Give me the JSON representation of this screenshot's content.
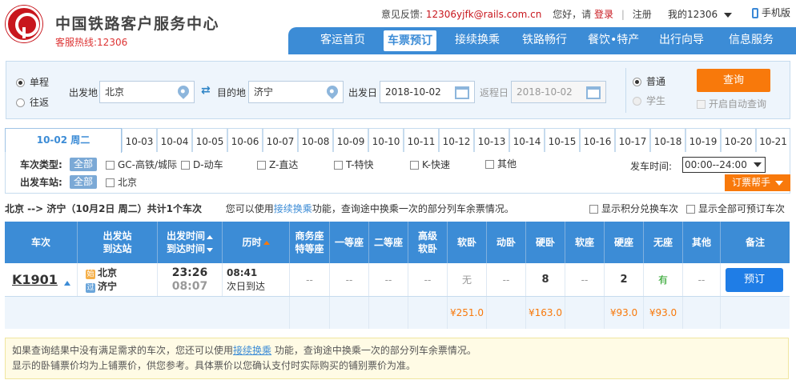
{
  "header": {
    "title": "中国铁路客户服务中心",
    "hotline": "客服热线:12306",
    "feedback_label": "意见反馈:",
    "feedback_email": "12306yjfk@rails.com.cn",
    "greeting": "您好，请",
    "login": "登录",
    "register": "注册",
    "my12306": "我的12306",
    "mobile": "手机版"
  },
  "nav": [
    "客运首页",
    "车票预订",
    "接续换乘",
    "铁路畅行",
    "餐饮•特产",
    "出行向导",
    "信息服务"
  ],
  "query": {
    "oneway": "单程",
    "roundtrip": "往返",
    "from_label": "出发地",
    "from_value": "北京",
    "to_label": "目的地",
    "to_value": "济宁",
    "depart_label": "出发日",
    "depart_value": "2018-10-02",
    "return_label": "返程日",
    "return_value": "2018-10-02",
    "normal": "普通",
    "student": "学生",
    "search": "查询",
    "auto_query": "开启自动查询"
  },
  "dates": [
    "10-02 周二",
    "10-03",
    "10-04",
    "10-05",
    "10-06",
    "10-07",
    "10-08",
    "10-09",
    "10-10",
    "10-11",
    "10-12",
    "10-13",
    "10-14",
    "10-15",
    "10-16",
    "10-17",
    "10-18",
    "10-19",
    "10-20",
    "10-21"
  ],
  "filters": {
    "type_label": "车次类型:",
    "all": "全部",
    "types": [
      "GC-高铁/城际",
      "D-动车",
      "Z-直达",
      "T-特快",
      "K-快速",
      "其他"
    ],
    "station_label": "出发车站:",
    "stations": [
      "北京"
    ],
    "time_label": "发车时间:",
    "time_value": "00:00--24:00",
    "help": "订票帮手"
  },
  "summary": {
    "route": "北京 --> 济宁（10月2日 周二）共计1个车次",
    "hint_pre": "您可以使用",
    "hint_link": "接续换乘",
    "hint_post": "功能，查询途中换乘一次的部分列车余票情况。",
    "opt1": "显示积分兑换车次",
    "opt2": "显示全部可预订车次"
  },
  "table": {
    "headers": {
      "train": "车次",
      "station_a": "出发站",
      "station_b": "到达站",
      "time_a": "出发时间",
      "time_b": "到达时间",
      "duration": "历时",
      "biz_a": "商务座",
      "biz_b": "特等座",
      "first": "一等座",
      "second": "二等座",
      "adv_a": "高级",
      "adv_b": "软卧",
      "soft_sleeper": "软卧",
      "moving_sleeper": "动卧",
      "hard_sleeper": "硬卧",
      "soft_seat": "软座",
      "hard_seat": "硬座",
      "no_seat": "无座",
      "other": "其他",
      "remark": "备注"
    },
    "row": {
      "train": "K1901",
      "from_badge": "始",
      "from": "北京",
      "to_badge": "过",
      "to": "济宁",
      "depart": "23:26",
      "arrive": "08:07",
      "duration": "08:41",
      "duration_note": "次日到达",
      "biz": "--",
      "first": "--",
      "second": "--",
      "adv": "--",
      "soft_sleeper": "无",
      "moving_sleeper": "--",
      "hard_sleeper": "8",
      "soft_seat": "--",
      "hard_seat": "2",
      "no_seat": "有",
      "other": "--",
      "book": "预订"
    },
    "prices": {
      "soft_sleeper": "¥251.0",
      "hard_sleeper": "¥163.0",
      "hard_seat": "¥93.0",
      "no_seat": "¥93.0"
    }
  },
  "notice": {
    "line1_pre": "如果查询结果中没有满足需求的车次，您还可以使用",
    "line1_link": "接续换乘",
    "line1_post": " 功能，查询途中换乘一次的部分列车余票情况。",
    "line2": "显示的卧铺票价均为上铺票价，供您参考。具体票价以您确认支付时实际购买的铺别票价为准。"
  }
}
